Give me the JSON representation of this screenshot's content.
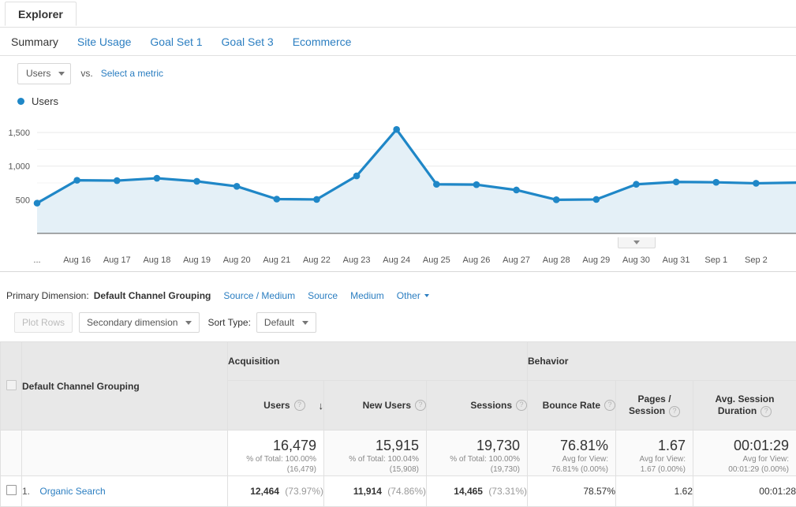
{
  "tab": {
    "label": "Explorer"
  },
  "subnav": {
    "items": [
      {
        "label": "Summary",
        "active": true
      },
      {
        "label": "Site Usage",
        "active": false
      },
      {
        "label": "Goal Set 1",
        "active": false
      },
      {
        "label": "Goal Set 3",
        "active": false
      },
      {
        "label": "Ecommerce",
        "active": false
      }
    ]
  },
  "metricbar": {
    "selected_metric": "Users",
    "vs_label": "vs.",
    "select_metric_link": "Select a metric"
  },
  "legend": {
    "label": "Users",
    "color": "#1f87c7"
  },
  "chart_data": {
    "type": "line",
    "title": "Users",
    "xlabel": "",
    "ylabel": "",
    "ylim": [
      0,
      1700
    ],
    "yticks": [
      500,
      1000,
      1500
    ],
    "ytick_labels": [
      "500",
      "1,000",
      "1,500"
    ],
    "grid": true,
    "legend_position": "top-left",
    "area_fill": "#e4f0f7",
    "line_color": "#1f87c7",
    "categories": [
      "...",
      "Aug 16",
      "Aug 17",
      "Aug 18",
      "Aug 19",
      "Aug 20",
      "Aug 21",
      "Aug 22",
      "Aug 23",
      "Aug 24",
      "Aug 25",
      "Aug 26",
      "Aug 27",
      "Aug 28",
      "Aug 29",
      "Aug 30",
      "Aug 31",
      "Sep 1",
      "Sep 2",
      ""
    ],
    "values": [
      450,
      790,
      785,
      820,
      775,
      700,
      510,
      505,
      855,
      1545,
      730,
      725,
      645,
      500,
      505,
      730,
      765,
      760,
      745,
      755
    ]
  },
  "chart_handle": {
    "icon": "chevron-down-icon"
  },
  "primary_dimension": {
    "label": "Primary Dimension:",
    "active": "Default Channel Grouping",
    "links": [
      "Source / Medium",
      "Source",
      "Medium"
    ],
    "other": "Other"
  },
  "toolbar": {
    "plot_rows": "Plot Rows",
    "secondary_dimension": "Secondary dimension",
    "sort_type_label": "Sort Type:",
    "sort_type_value": "Default"
  },
  "table": {
    "dimension_header": "Default Channel Grouping",
    "groups": [
      {
        "label": "Acquisition",
        "span": 3
      },
      {
        "label": "Behavior",
        "span": 3
      }
    ],
    "columns": [
      {
        "label": "Users",
        "help": "?",
        "sorted": true,
        "sort_icon": "↓"
      },
      {
        "label": "New Users",
        "help": "?",
        "sorted": false
      },
      {
        "label": "Sessions",
        "help": "?",
        "sorted": false
      },
      {
        "label": "Bounce Rate",
        "help": "?",
        "sorted": false
      },
      {
        "label": "Pages /\nSession",
        "line1": "Pages /",
        "line2": "Session",
        "help": "?",
        "sorted": false
      },
      {
        "label": "Avg. Session Duration",
        "line1": "Avg. Session",
        "line2": "Duration",
        "help": "?",
        "sorted": false
      }
    ],
    "totals": [
      {
        "value": "16,479",
        "sub1": "% of Total: 100.00%",
        "sub2": "(16,479)"
      },
      {
        "value": "15,915",
        "sub1": "% of Total: 100.04%",
        "sub2": "(15,908)"
      },
      {
        "value": "19,730",
        "sub1": "% of Total: 100.00%",
        "sub2": "(19,730)"
      },
      {
        "value": "76.81%",
        "sub1": "Avg for View:",
        "sub2": "76.81% (0.00%)"
      },
      {
        "value": "1.67",
        "sub1": "Avg for View:",
        "sub2": "1.67 (0.00%)"
      },
      {
        "value": "00:01:29",
        "sub1": "Avg for View:",
        "sub2": "00:01:29 (0.00%)"
      }
    ],
    "rows": [
      {
        "index": "1.",
        "name": "Organic Search",
        "cells": [
          {
            "value": "12,464",
            "pct": "(73.97%)"
          },
          {
            "value": "11,914",
            "pct": "(74.86%)"
          },
          {
            "value": "14,465",
            "pct": "(73.31%)"
          },
          {
            "value": "78.57%",
            "pct": ""
          },
          {
            "value": "1.62",
            "pct": ""
          },
          {
            "value": "00:01:28",
            "pct": ""
          }
        ]
      }
    ]
  }
}
